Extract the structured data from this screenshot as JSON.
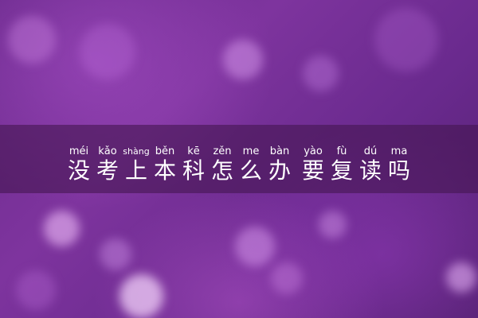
{
  "title": {
    "characters": [
      {
        "pinyin": "méi",
        "hanzi": "没"
      },
      {
        "pinyin": "kǎo",
        "hanzi": "考"
      },
      {
        "pinyin": "shàng",
        "hanzi": "上"
      },
      {
        "pinyin": "běn",
        "hanzi": "本"
      },
      {
        "pinyin": "kē",
        "hanzi": "科"
      },
      {
        "pinyin": "zěn",
        "hanzi": "怎"
      },
      {
        "pinyin": "me",
        "hanzi": "么"
      },
      {
        "pinyin": "bàn",
        "hanzi": "办"
      },
      {
        "pinyin": "yào",
        "hanzi": "要"
      },
      {
        "pinyin": "fù",
        "hanzi": "复"
      },
      {
        "pinyin": "dú",
        "hanzi": "读"
      },
      {
        "pinyin": "ma",
        "hanzi": "吗"
      }
    ]
  },
  "colors": {
    "background": "#6b2a8c",
    "band": "#461652",
    "text": "#ffffff"
  }
}
